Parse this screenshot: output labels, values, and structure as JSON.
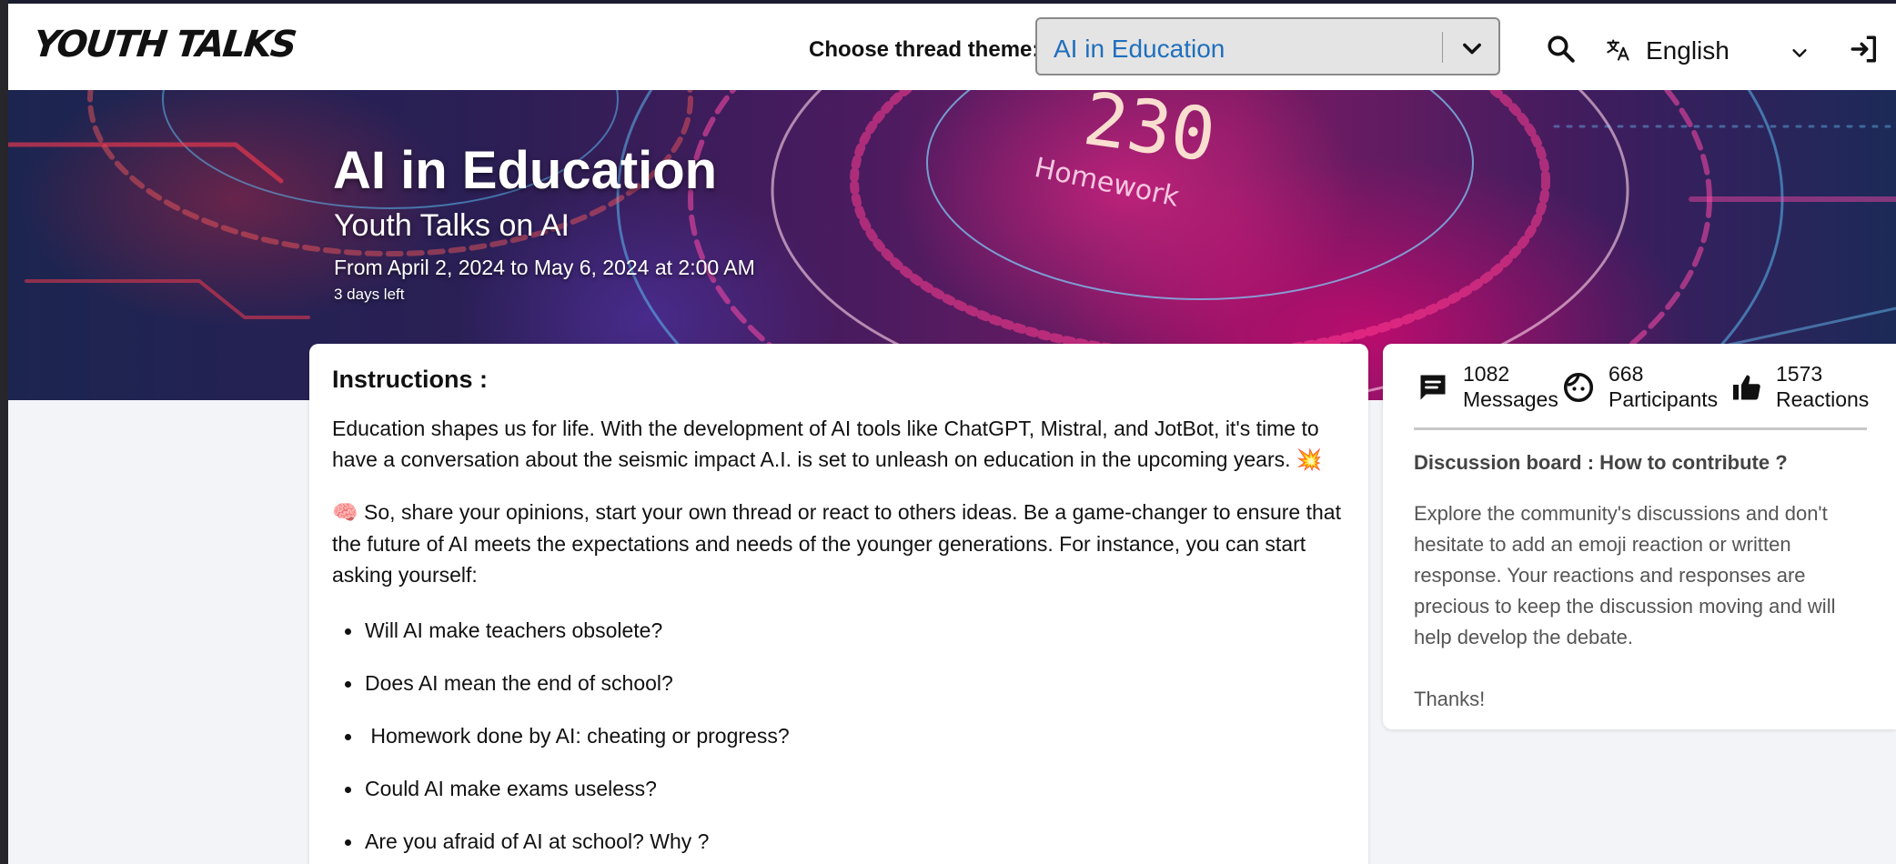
{
  "header": {
    "logo": "YOUTH TALKS",
    "theme_label": "Choose thread theme:",
    "theme_value": "AI in Education",
    "language": "English"
  },
  "hero": {
    "title": "AI in Education",
    "subtitle": "Youth Talks on AI",
    "dates": "From April 2, 2024 to May 6, 2024 at 2:00 AM",
    "time_left": "3 days left",
    "image_text_big": "230",
    "image_text_small": "Homework"
  },
  "instructions": {
    "title": "Instructions :",
    "para1": "Education shapes us for life. With the development of AI tools like ChatGPT, Mistral, and JotBot, it's time to have a conversation about the seismic impact A.I. is set to unleash on education in the upcoming years.",
    "para1_emoji": "💥",
    "para2_emoji": "🧠",
    "para2": "So, share your opinions, start your own thread or react to others ideas. Be a game-changer to ensure that the future of AI meets the expectations and needs of the younger generations.  For instance, you can start asking yourself:",
    "questions": [
      "Will AI make teachers obsolete?",
      "Does AI mean the end of school?",
      " Homework done by AI: cheating or progress?",
      "Could AI make exams useless?",
      "Are you afraid of AI at school? Why ?"
    ]
  },
  "stats": {
    "messages_count": "1082",
    "messages_label": "Messages",
    "participants_count": "668",
    "participants_label": "Participants",
    "reactions_count": "1573",
    "reactions_label": "Reactions"
  },
  "sidebar": {
    "title": "Discussion board : How to contribute ?",
    "text": "Explore the community's discussions and don't hesitate to add an emoji reaction or written response. Your reactions and responses are precious to keep the discussion moving and will help develop the debate.",
    "thanks": "Thanks!"
  },
  "colors": {
    "theme_value": "#1f6fbd",
    "background": "#f3f4f8"
  }
}
